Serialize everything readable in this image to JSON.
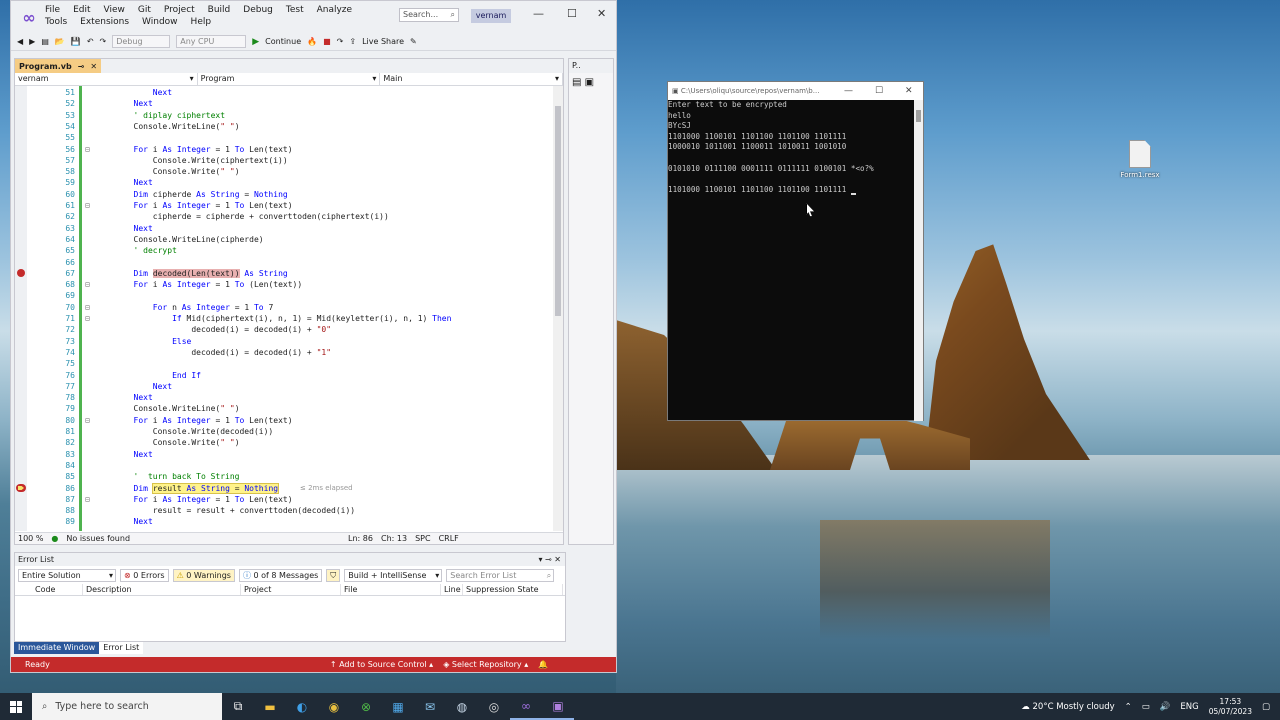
{
  "vs": {
    "menu": [
      "File",
      "Edit",
      "View",
      "Git",
      "Project",
      "Build",
      "Debug",
      "Test",
      "Analyze",
      "Tools",
      "Extensions",
      "Window",
      "Help"
    ],
    "search_placeholder": "Search...",
    "solution": "vernam",
    "toolbar": {
      "config": "Debug",
      "platform": "Any CPU",
      "continue": "Continue",
      "live_share": "Live Share"
    },
    "tab_name": "Program.vb",
    "nav": {
      "project": "vernam",
      "class": "Program",
      "member": "Main"
    },
    "code": [
      {
        "n": "51",
        "t": "            Next"
      },
      {
        "n": "52",
        "t": "        Next"
      },
      {
        "n": "53",
        "t": "        ' diplay ciphertext"
      },
      {
        "n": "54",
        "t": "        Console.WriteLine(\" \")"
      },
      {
        "n": "55",
        "t": ""
      },
      {
        "n": "56",
        "t": "        For i As Integer = 1 To Len(text)"
      },
      {
        "n": "57",
        "t": "            Console.Write(ciphertext(i))"
      },
      {
        "n": "58",
        "t": "            Console.Write(\" \")"
      },
      {
        "n": "59",
        "t": "        Next"
      },
      {
        "n": "60",
        "t": "        Dim cipherde As String = Nothing"
      },
      {
        "n": "61",
        "t": "        For i As Integer = 1 To Len(text)"
      },
      {
        "n": "62",
        "t": "            cipherde = cipherde + converttoden(ciphertext(i))"
      },
      {
        "n": "63",
        "t": "        Next"
      },
      {
        "n": "64",
        "t": "        Console.WriteLine(cipherde)"
      },
      {
        "n": "65",
        "t": "        ' decrypt"
      },
      {
        "n": "66",
        "t": ""
      },
      {
        "n": "67",
        "t": "        Dim decoded(Len(text)) As String"
      },
      {
        "n": "68",
        "t": "        For i As Integer = 1 To (Len(text))"
      },
      {
        "n": "69",
        "t": ""
      },
      {
        "n": "70",
        "t": "            For n As Integer = 1 To 7"
      },
      {
        "n": "71",
        "t": "                If Mid(ciphertext(i), n, 1) = Mid(keyletter(i), n, 1) Then"
      },
      {
        "n": "72",
        "t": "                    decoded(i) = decoded(i) + \"0\""
      },
      {
        "n": "73",
        "t": "                Else"
      },
      {
        "n": "74",
        "t": "                    decoded(i) = decoded(i) + \"1\""
      },
      {
        "n": "75",
        "t": ""
      },
      {
        "n": "76",
        "t": "                End If"
      },
      {
        "n": "77",
        "t": "            Next"
      },
      {
        "n": "78",
        "t": "        Next"
      },
      {
        "n": "79",
        "t": "        Console.WriteLine(\" \")"
      },
      {
        "n": "80",
        "t": "        For i As Integer = 1 To Len(text)"
      },
      {
        "n": "81",
        "t": "            Console.Write(decoded(i))"
      },
      {
        "n": "82",
        "t": "            Console.Write(\" \")"
      },
      {
        "n": "83",
        "t": "        Next"
      },
      {
        "n": "84",
        "t": ""
      },
      {
        "n": "85",
        "t": "        '  turn back To String"
      },
      {
        "n": "86",
        "t": "        Dim result As String = Nothing"
      },
      {
        "n": "87",
        "t": "        For i As Integer = 1 To Len(text)"
      },
      {
        "n": "88",
        "t": "            result = result + converttoden(decoded(i))"
      },
      {
        "n": "89",
        "t": "        Next"
      }
    ],
    "elapsed": "≤ 2ms elapsed",
    "status": {
      "zoom": "100 %",
      "issues": "No issues found",
      "ln": "Ln: 86",
      "ch": "Ch: 13",
      "spc": "SPC",
      "crlf": "CRLF"
    },
    "side_tab": "P..",
    "error_list": {
      "title": "Error List",
      "scope": "Entire Solution",
      "errors": "0 Errors",
      "warnings": "0 Warnings",
      "messages": "0 of 8 Messages",
      "build": "Build + IntelliSense",
      "search": "Search Error List",
      "columns": [
        "Code",
        "Description",
        "Project",
        "File",
        "Line",
        "Suppression State"
      ]
    },
    "bottom_tabs": [
      "Immediate Window",
      "Error List"
    ],
    "statusbar": {
      "ready": "Ready",
      "source": "Add to Source Control",
      "repo": "Select Repository"
    }
  },
  "console": {
    "title": "C:\\Users\\oliqu\\source\\repos\\vernam\\b...",
    "lines": [
      "Enter text to be encrypted",
      "hello",
      "BYcSJ",
      "1101000 1100101 1101100 1101100 1101111",
      "1000010 1011001 1100011 1010011 1001010",
      "",
      "0101010 0111100 0001111 0111111 0100101 *<o?%",
      "",
      "1101000 1100101 1101100 1101100 1101111 "
    ]
  },
  "desktop_icon": "Form1.resx",
  "taskbar": {
    "search": "Type here to search",
    "weather": "20°C  Mostly cloudy",
    "lang": "ENG",
    "time": "17:53",
    "date": "05/07/2023"
  },
  "colors": {
    "vs_status": "#c42b2b",
    "tab_active": "#f5cc84",
    "changebar": "#4fb34f"
  }
}
